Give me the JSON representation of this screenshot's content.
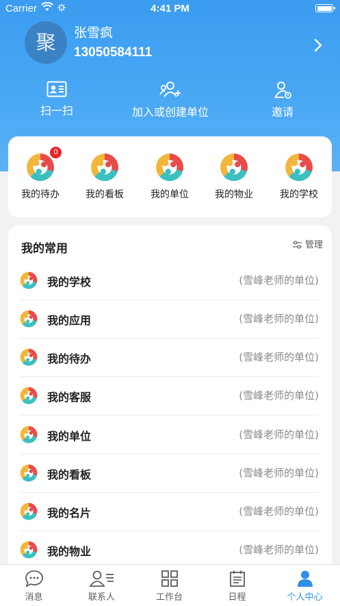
{
  "status_bar": {
    "carrier": "Carrier",
    "time": "4:41 PM"
  },
  "profile": {
    "avatar_char": "聚",
    "name": "张雪疯",
    "phone": "13050584111"
  },
  "quick_actions": [
    {
      "label": "扫一扫",
      "icon": "id-card-icon"
    },
    {
      "label": "加入或创建单位",
      "icon": "add-group-icon"
    },
    {
      "label": "邀请",
      "icon": "invite-icon"
    }
  ],
  "entries": [
    {
      "label": "我的待办",
      "badge": "0"
    },
    {
      "label": "我的看板"
    },
    {
      "label": "我的单位"
    },
    {
      "label": "我的物业"
    },
    {
      "label": "我的学校"
    }
  ],
  "favorites": {
    "title": "我的常用",
    "manage_label": "管理",
    "items": [
      {
        "label": "我的学校",
        "sub": "(雪峰老师的单位)"
      },
      {
        "label": "我的应用",
        "sub": "(雪峰老师的单位)"
      },
      {
        "label": "我的待办",
        "sub": "(雪峰老师的单位)"
      },
      {
        "label": "我的客服",
        "sub": "(雪峰老师的单位)"
      },
      {
        "label": "我的单位",
        "sub": "(雪峰老师的单位)"
      },
      {
        "label": "我的看板",
        "sub": "(雪峰老师的单位)"
      },
      {
        "label": "我的名片",
        "sub": "(雪峰老师的单位)"
      },
      {
        "label": "我的物业",
        "sub": "(雪峰老师的单位)"
      }
    ]
  },
  "tabbar": [
    {
      "label": "消息",
      "icon": "chat-icon"
    },
    {
      "label": "联系人",
      "icon": "contacts-icon"
    },
    {
      "label": "工作台",
      "icon": "grid-icon"
    },
    {
      "label": "日程",
      "icon": "calendar-icon"
    },
    {
      "label": "个人中心",
      "icon": "person-icon",
      "active": true
    }
  ],
  "colors": {
    "accent": "#2f8fe8",
    "header": "#3b9cf0",
    "badge": "#e8262b"
  }
}
